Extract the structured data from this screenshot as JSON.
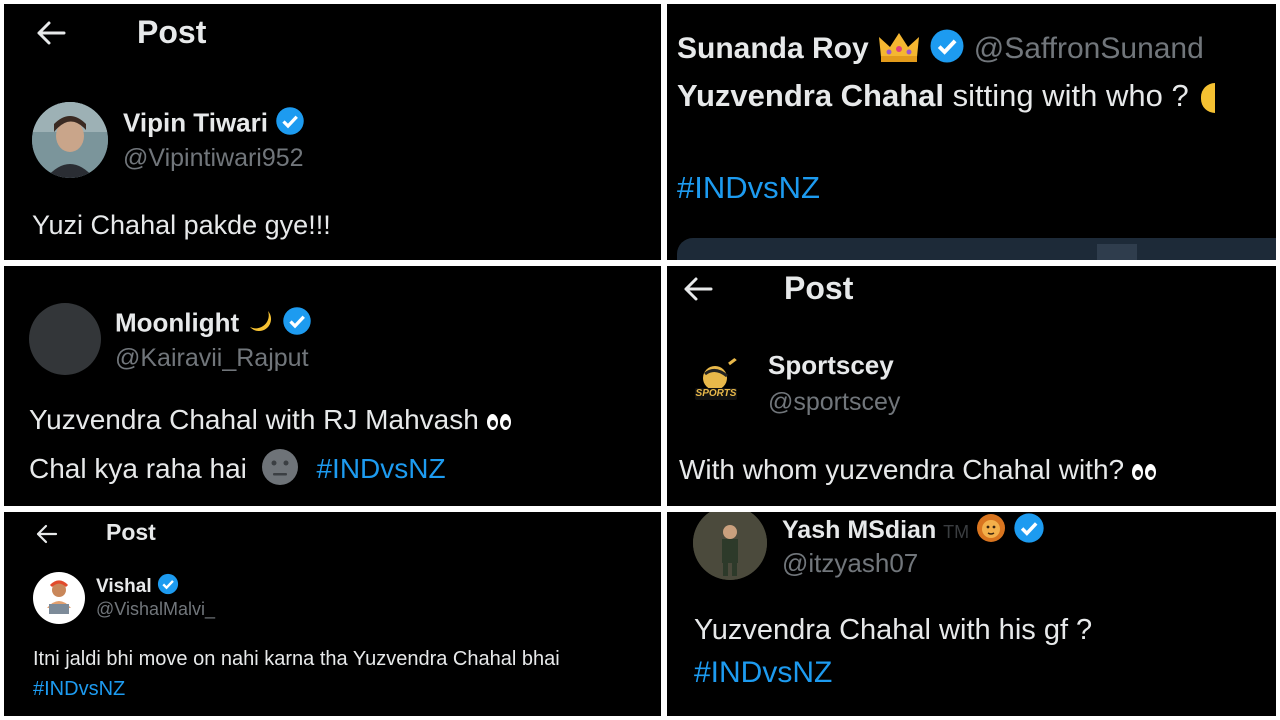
{
  "colors": {
    "background": "#000000",
    "text": "#e7e9ea",
    "muted": "#71767b",
    "accent": "#1d9bf0"
  },
  "panels": [
    {
      "header_title": "Post",
      "name": "Vipin Tiwari",
      "handle": "@Vipintiwari952",
      "verified": true,
      "text": "Yuzi Chahal pakde gye!!!"
    },
    {
      "name": "Sunanda Roy",
      "name_emoji": "crown",
      "handle": "@SaffronSunand",
      "verified": true,
      "text_bold": "Yuzvendra Chahal",
      "text": " sitting with who ?",
      "hashtag": "#INDvsNZ"
    },
    {
      "name": "Moonlight",
      "name_emoji": "crescent-moon",
      "handle": "@Kairavii_Rajput",
      "verified": true,
      "line1": "Yuzvendra Chahal with RJ Mahvash",
      "line1_emoji": "eyes",
      "line2": "Chal kya raha hai",
      "line2_emoji": "neutral-face",
      "hashtag": "#INDvsNZ"
    },
    {
      "header_title": "Post",
      "name": "Sportscey",
      "handle": "@sportscey",
      "avatar_text": "SPORTS",
      "text": "With whom yuzvendra Chahal with?",
      "text_emoji": "eyes"
    },
    {
      "header_title": "Post",
      "name": "Vishal",
      "handle": "@VishalMalvi_",
      "verified": true,
      "text": "Itni jaldi bhi move on nahi karna tha Yuzvendra Chahal bhai",
      "hashtag": "#INDvsNZ"
    },
    {
      "name": "Yash MSdian",
      "name_suffix": "TM",
      "name_emoji": "lion",
      "handle": "@itzyash07",
      "verified": true,
      "text": "Yuzvendra Chahal  with his gf ?",
      "hashtag": "#INDvsNZ"
    }
  ]
}
